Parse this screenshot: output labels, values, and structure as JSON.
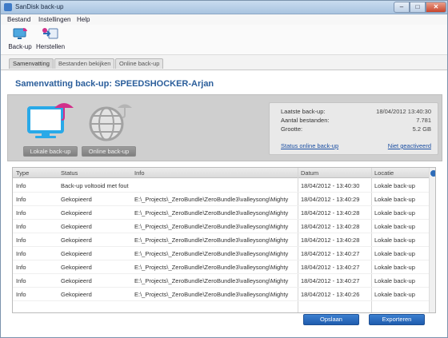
{
  "window": {
    "title": "SanDisk back-up",
    "min": "–",
    "max": "□",
    "close": "✕"
  },
  "menu": [
    "Bestand",
    "Instellingen",
    "Help"
  ],
  "toolbar": {
    "backup_label": "Back-up",
    "restore_label": "Herstellen"
  },
  "tabs": [
    "Samenvatting",
    "Bestanden bekijken",
    "Online back-up"
  ],
  "summary": {
    "heading": "Samenvatting back-up: SPEEDSHOCKER-Arjan",
    "local_backup_button": "Lokale back-up",
    "online_backup_button": "Online back-up",
    "last_backup_label": "Laatste back-up:",
    "last_backup_value": "18/04/2012    13:40:30",
    "file_count_label": "Aantal bestanden:",
    "file_count_value": "7.781",
    "size_label": "Grootte:",
    "size_value": "5.2 GB",
    "online_status_link": "Status online back-up",
    "not_registered_link": "Niet geactiveerd"
  },
  "log": {
    "columns": [
      "Type",
      "Status",
      "Info",
      "Datum",
      "Locatie"
    ],
    "rows": [
      [
        "Info",
        "Back-up voltooid met fout",
        "",
        "18/04/2012 - 13:40:30",
        "Lokale back-up"
      ],
      [
        "Info",
        "Gekopieerd",
        "E:\\_Projects\\_ZeroBundle\\ZeroBundle3\\valleysong\\Mighty",
        "18/04/2012 - 13:40:29",
        "Lokale back-up"
      ],
      [
        "Info",
        "Gekopieerd",
        "E:\\_Projects\\_ZeroBundle\\ZeroBundle3\\valleysong\\Mighty",
        "18/04/2012 - 13:40:28",
        "Lokale back-up"
      ],
      [
        "Info",
        "Gekopieerd",
        "E:\\_Projects\\_ZeroBundle\\ZeroBundle3\\valleysong\\Mighty",
        "18/04/2012 - 13:40:28",
        "Lokale back-up"
      ],
      [
        "Info",
        "Gekopieerd",
        "E:\\_Projects\\_ZeroBundle\\ZeroBundle3\\valleysong\\Mighty",
        "18/04/2012 - 13:40:28",
        "Lokale back-up"
      ],
      [
        "Info",
        "Gekopieerd",
        "E:\\_Projects\\_ZeroBundle\\ZeroBundle3\\valleysong\\Mighty",
        "18/04/2012 - 13:40:27",
        "Lokale back-up"
      ],
      [
        "Info",
        "Gekopieerd",
        "E:\\_Projects\\_ZeroBundle\\ZeroBundle3\\valleysong\\Mighty",
        "18/04/2012 - 13:40:27",
        "Lokale back-up"
      ],
      [
        "Info",
        "Gekopieerd",
        "E:\\_Projects\\_ZeroBundle\\ZeroBundle3\\valleysong\\Mighty",
        "18/04/2012 - 13:40:27",
        "Lokale back-up"
      ],
      [
        "Info",
        "Gekopieerd",
        "E:\\_Projects\\_ZeroBundle\\ZeroBundle3\\valleysong\\Mighty",
        "18/04/2012 - 13:40:26",
        "Lokale back-up"
      ]
    ]
  },
  "footer": {
    "save_button": "Opslaan",
    "export_button": "Exporteren"
  },
  "colors": {
    "accent": "#2b5e9b",
    "button_blue": "#1f5cae",
    "umbrella": "#d2308a"
  }
}
